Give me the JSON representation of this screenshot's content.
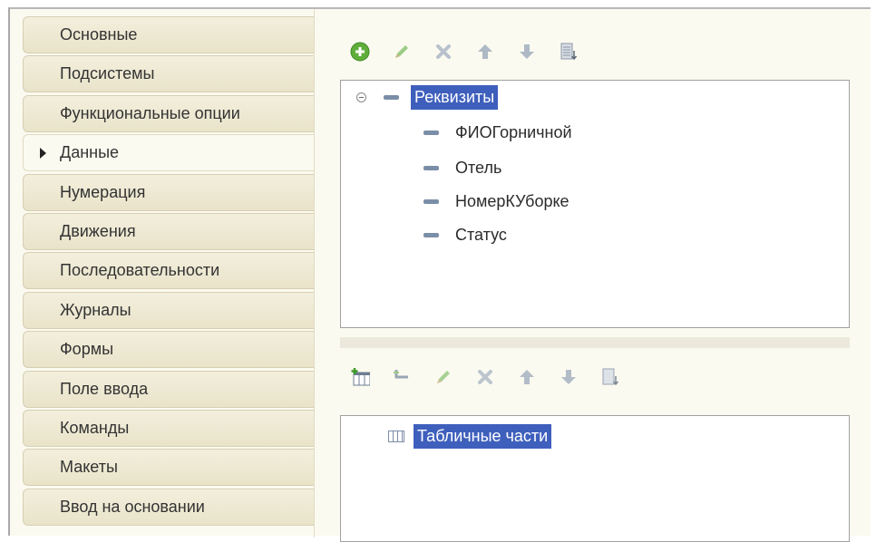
{
  "sidebar": {
    "tabs": [
      {
        "label": "Основные"
      },
      {
        "label": "Подсистемы"
      },
      {
        "label": "Функциональные опции"
      },
      {
        "label": "Данные",
        "active": true
      },
      {
        "label": "Нумерация"
      },
      {
        "label": "Движения"
      },
      {
        "label": "Последовательности"
      },
      {
        "label": "Журналы"
      },
      {
        "label": "Формы"
      },
      {
        "label": "Поле ввода"
      },
      {
        "label": "Команды"
      },
      {
        "label": "Макеты"
      },
      {
        "label": "Ввод на основании"
      }
    ]
  },
  "attributes": {
    "toolbar": [
      "add-icon",
      "edit-icon",
      "delete-icon",
      "move-up-icon",
      "move-down-icon",
      "sort-icon"
    ],
    "root": "Реквизиты",
    "items": [
      "ФИОГорничной",
      "Отель",
      "НомерКУборке",
      "Статус"
    ]
  },
  "tabular": {
    "toolbar": [
      "add-table-icon",
      "add-column-icon",
      "edit-icon",
      "delete-icon",
      "move-up-icon",
      "move-down-icon",
      "sort-icon"
    ],
    "root": "Табличные части"
  },
  "colors": {
    "selection": "#3f5fbd",
    "tab_bg": "#ece6cd",
    "panel_bg": "#fbfaf0"
  }
}
